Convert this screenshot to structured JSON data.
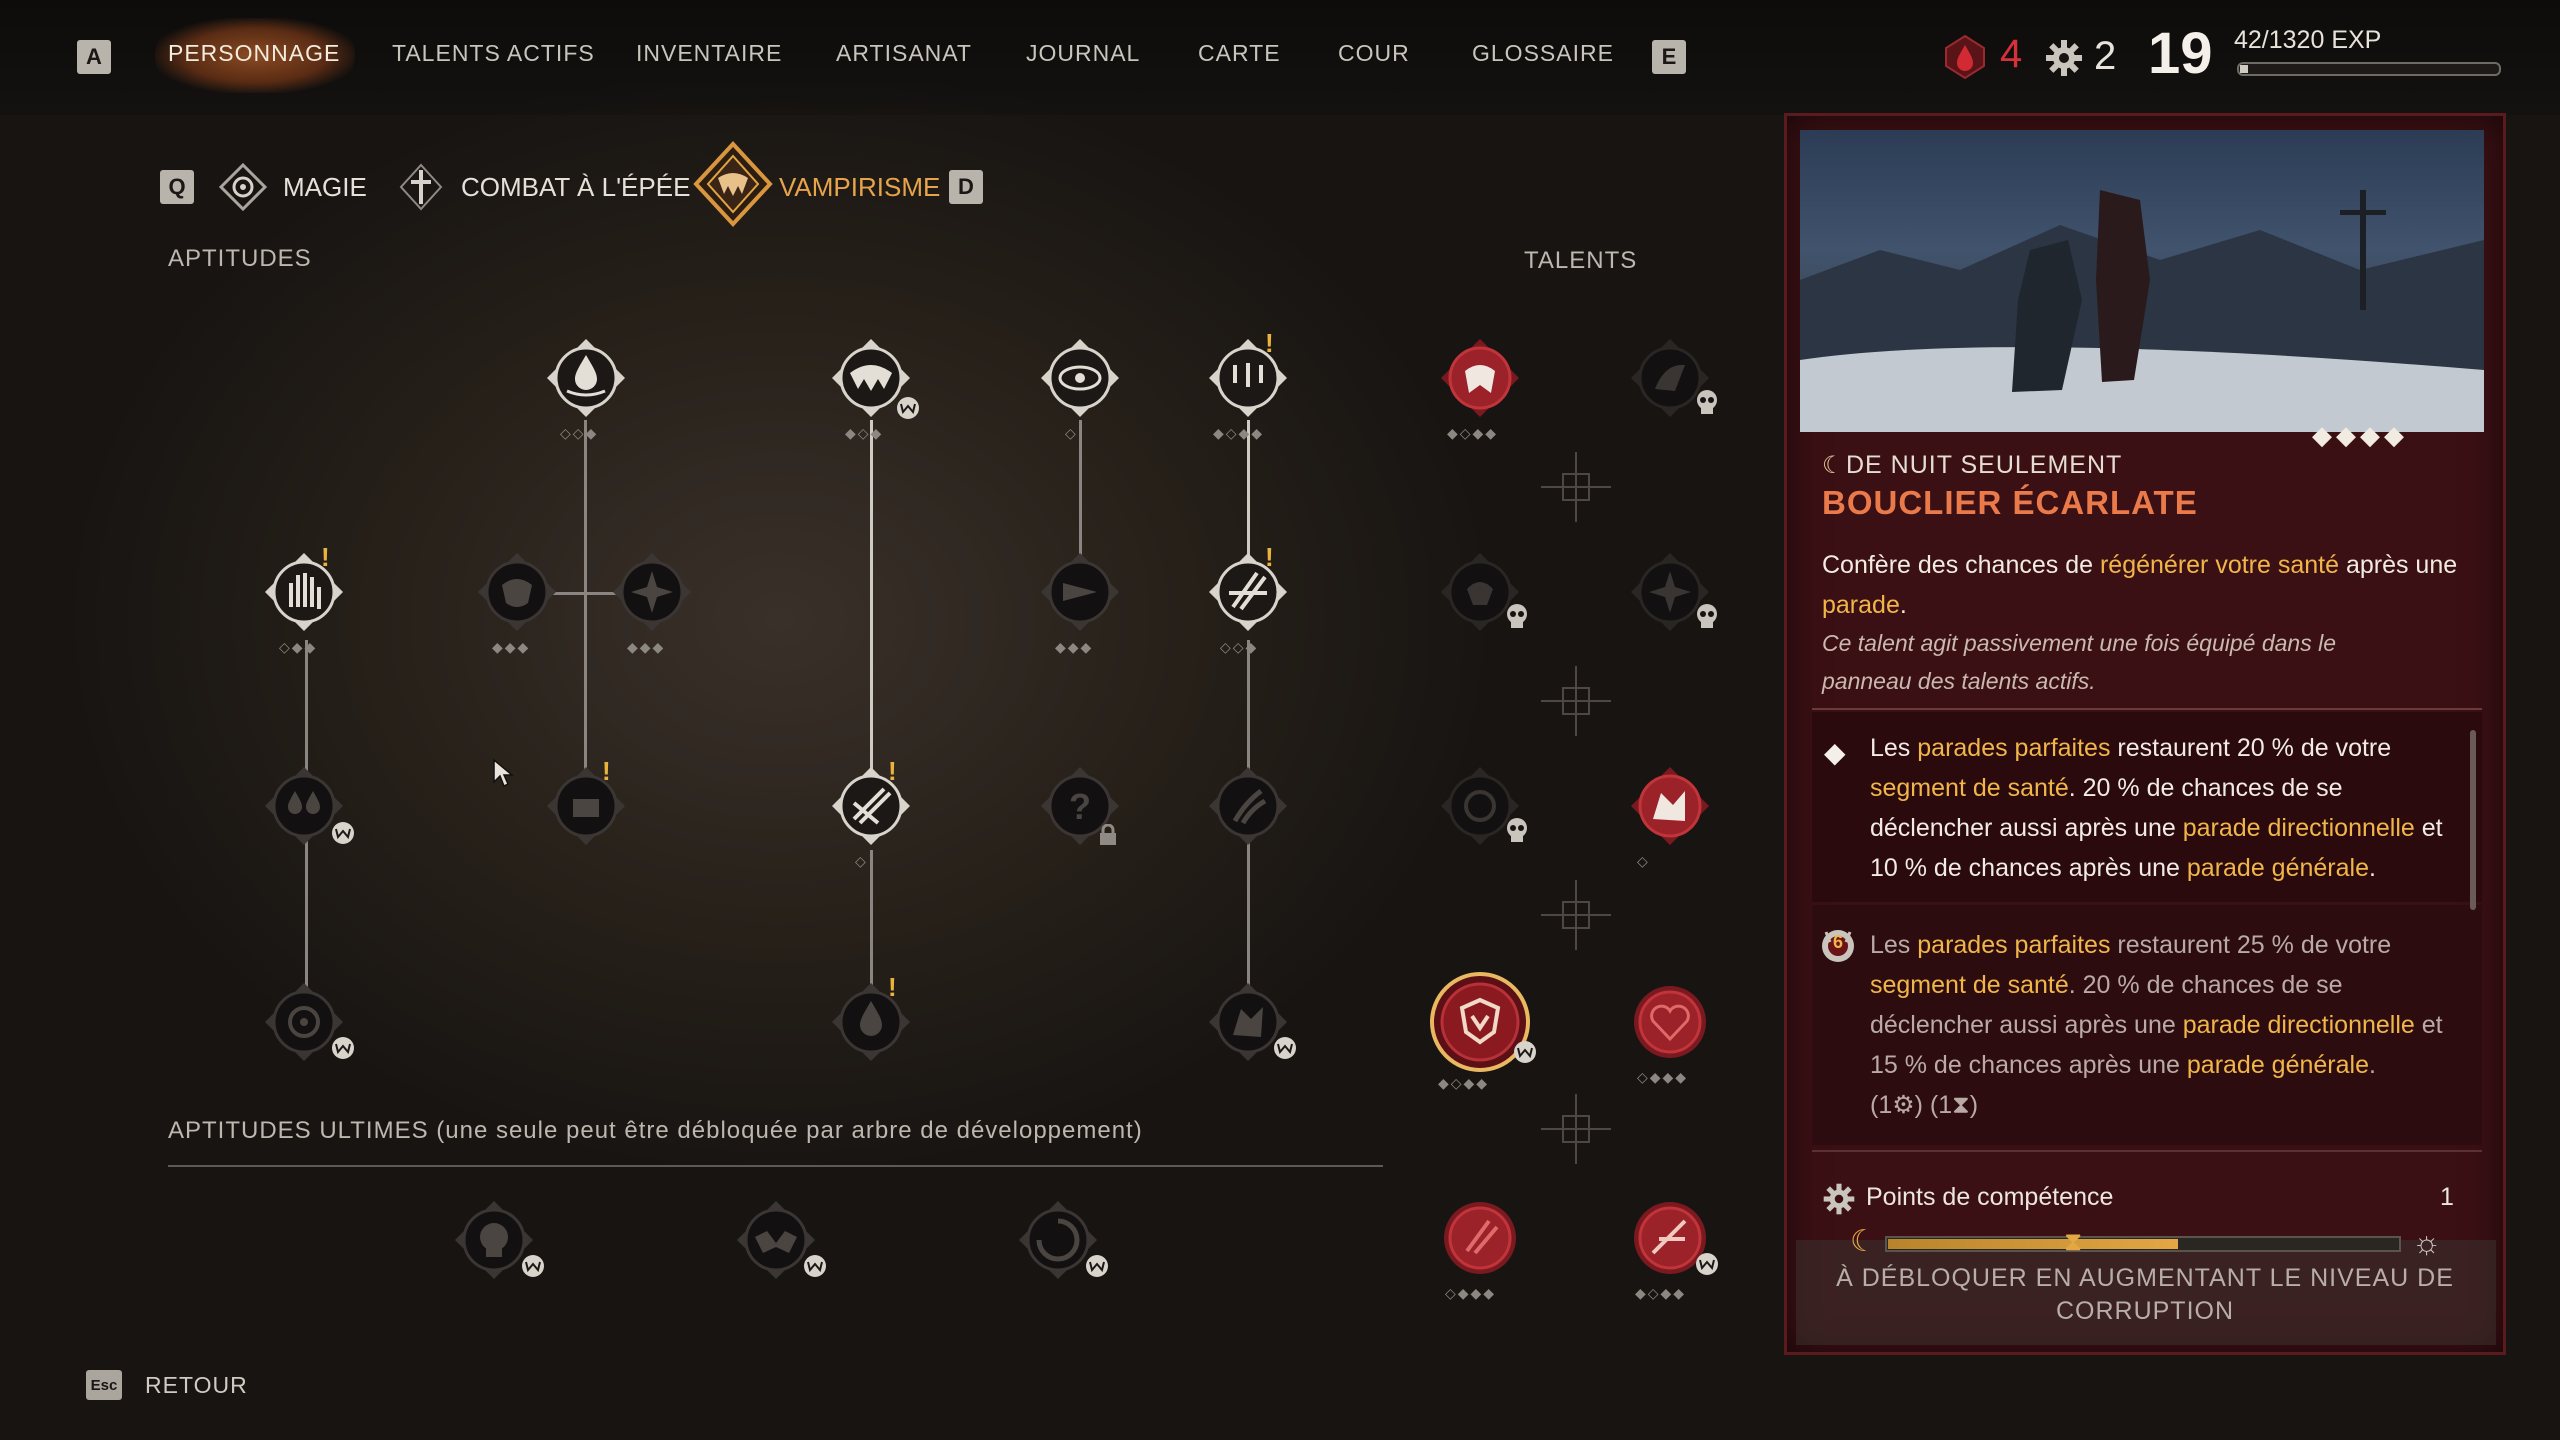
{
  "top_nav": {
    "key_left": "A",
    "key_right": "E",
    "tabs": [
      "PERSONNAGE",
      "TALENTS ACTIFS",
      "INVENTAIRE",
      "ARTISANAT",
      "JOURNAL",
      "CARTE",
      "COUR",
      "GLOSSAIRE"
    ],
    "active_tab": "PERSONNAGE"
  },
  "stats": {
    "blood_points": "4",
    "skill_points": "2",
    "level": "19",
    "exp": "42/1320 EXP",
    "exp_progress": 0.032
  },
  "sub_tabs": {
    "key_left": "Q",
    "key_right": "D",
    "items": [
      "MAGIE",
      "COMBAT À L'ÉPÉE",
      "VAMPIRISME"
    ],
    "active": "VAMPIRISME"
  },
  "labels": {
    "aptitudes": "APTITUDES",
    "talents": "TALENTS",
    "ultimates": "APTITUDES ULTIMES (une seule peut être débloquée par arbre de développement)",
    "back_key": "Esc",
    "back": "RETOUR"
  },
  "detail_panel": {
    "subtitle": "DE NUIT SEULEMENT",
    "title": "BOUCLIER ÉCARLATE",
    "intro_1": "Confère des chances de ",
    "intro_hl_1": "régénérer votre santé",
    "intro_2": " après une ",
    "intro_hl_2": "parade",
    "intro_3": ".",
    "note": "Ce talent agit passivement une fois équipé dans le panneau des talents actifs.",
    "level1": {
      "t1": "Les ",
      "h1": "parades parfaites",
      "t2": " restaurent 20 % de votre ",
      "h2": "segment de santé",
      "t3": ". 20 % de chances de se déclencher aussi après une ",
      "h3": "parade directionnelle",
      "t4": " et 10 % de chances après une ",
      "h4": "parade générale",
      "t5": "."
    },
    "level2": {
      "badge": "6",
      "t1": "Les ",
      "h1": "parades parfaites",
      "t2": " restaurent 25 % de votre ",
      "h2": "segment de santé",
      "t3": ". 20 % de chances de se déclencher aussi après une ",
      "h3": "parade directionnelle",
      "t4": " et 15 % de chances après une ",
      "h4": "parade générale",
      "t5": ".",
      "cost": "(1⚙) (1⧗)"
    },
    "skill_points_label": "Points de compétence",
    "skill_points_value": "1",
    "unlock_text": "À DÉBLOQUER EN AUGMENTANT LE NIVEAU DE CORRUPTION"
  },
  "colors": {
    "accent_gold": "#f0b64a",
    "panel_red": "#3b1014",
    "active_orange": "#e7a44a",
    "blood_red": "#c8262e"
  }
}
